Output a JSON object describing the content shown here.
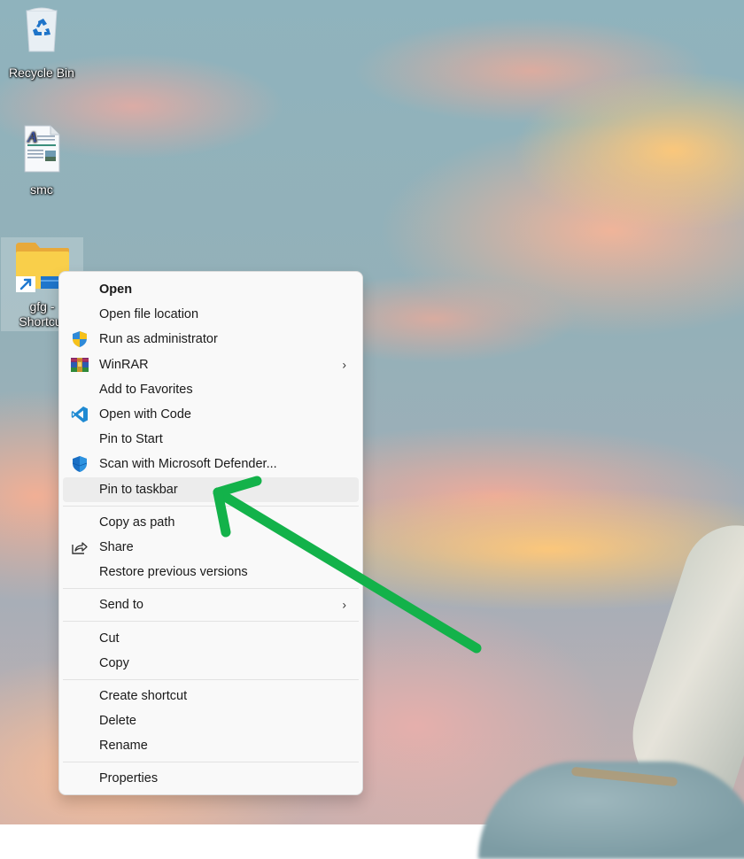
{
  "desktop": {
    "icons": [
      {
        "label": "Recycle Bin",
        "icon": "recycle-bin-icon"
      },
      {
        "label": "smc",
        "icon": "document-icon"
      },
      {
        "label": "gfg -\nShortcut",
        "label_line1": "gfg -",
        "label_line2": "Shortcut",
        "icon": "folder-shortcut-icon",
        "selected": true
      }
    ]
  },
  "context_menu": {
    "groups": [
      [
        {
          "label": "Open",
          "bold": true,
          "icon": null
        },
        {
          "label": "Open file location",
          "icon": null
        },
        {
          "label": "Run as administrator",
          "icon": "uac-shield-icon"
        },
        {
          "label": "WinRAR",
          "icon": "winrar-icon",
          "submenu": true
        },
        {
          "label": "Add to Favorites",
          "icon": null
        },
        {
          "label": "Open with Code",
          "icon": "vscode-icon"
        },
        {
          "label": "Pin to Start",
          "icon": null
        },
        {
          "label": "Scan with Microsoft Defender...",
          "icon": "defender-shield-icon"
        },
        {
          "label": "Pin to taskbar",
          "icon": null,
          "highlighted": true
        }
      ],
      [
        {
          "label": "Copy as path",
          "icon": null
        },
        {
          "label": "Share",
          "icon": "share-icon"
        },
        {
          "label": "Restore previous versions",
          "icon": null
        }
      ],
      [
        {
          "label": "Send to",
          "icon": null,
          "submenu": true
        }
      ],
      [
        {
          "label": "Cut",
          "icon": null
        },
        {
          "label": "Copy",
          "icon": null
        }
      ],
      [
        {
          "label": "Create shortcut",
          "icon": null
        },
        {
          "label": "Delete",
          "icon": null
        },
        {
          "label": "Rename",
          "icon": null
        }
      ],
      [
        {
          "label": "Properties",
          "icon": null
        }
      ]
    ],
    "submenu_glyph": "›"
  },
  "annotation": {
    "type": "arrow",
    "color": "#13b24a",
    "points_to": "Pin to taskbar"
  },
  "colors": {
    "menu_bg": "#f9f9f9",
    "menu_hover": "#ececec",
    "separator": "#e2e2e2",
    "folder_yellow": "#f8c83c",
    "shortcut_arrow": "#1e78d0"
  }
}
